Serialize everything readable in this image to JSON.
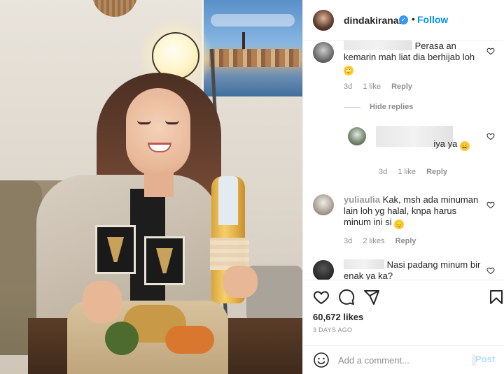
{
  "post": {
    "username": "dindakirana.s",
    "follow_label": "Follow",
    "separator": "•",
    "more_label": "⋯"
  },
  "comments": [
    {
      "text_after_blur": "Perasa an kemarin mah liat dia berhijab loh",
      "emoji": "🙄",
      "time": "3d",
      "likes": "1 like",
      "reply": "Reply"
    },
    {
      "hide_replies": "Hide replies"
    },
    {
      "text_after_blur": "iya ya",
      "emoji": "😄",
      "time": "3d",
      "likes": "1 like",
      "reply": "Reply"
    },
    {
      "username_partial": "yuliaulia",
      "text": "Kak, msh ada minuman lain loh yg halal, knpa harus minum ini si",
      "emoji": "😞",
      "time": "3d",
      "likes": "2 likes",
      "reply": "Reply"
    },
    {
      "text_after_blur": "Nasi padang minum bir enak ya ka?"
    }
  ],
  "footer": {
    "likes_count": "60,672 likes",
    "time_ago": "3 DAYS AGO",
    "comment_placeholder": "Add a comment...",
    "post_label": "Post"
  },
  "icons": [
    "heart-icon",
    "comment-icon",
    "share-icon",
    "bookmark-icon",
    "smiley-icon",
    "verified-icon"
  ],
  "colors": {
    "link_blue": "#0095f6",
    "verified_blue": "#3897f0",
    "meta_gray": "#8e8e8e",
    "post_disabled": "#b2dffc"
  }
}
